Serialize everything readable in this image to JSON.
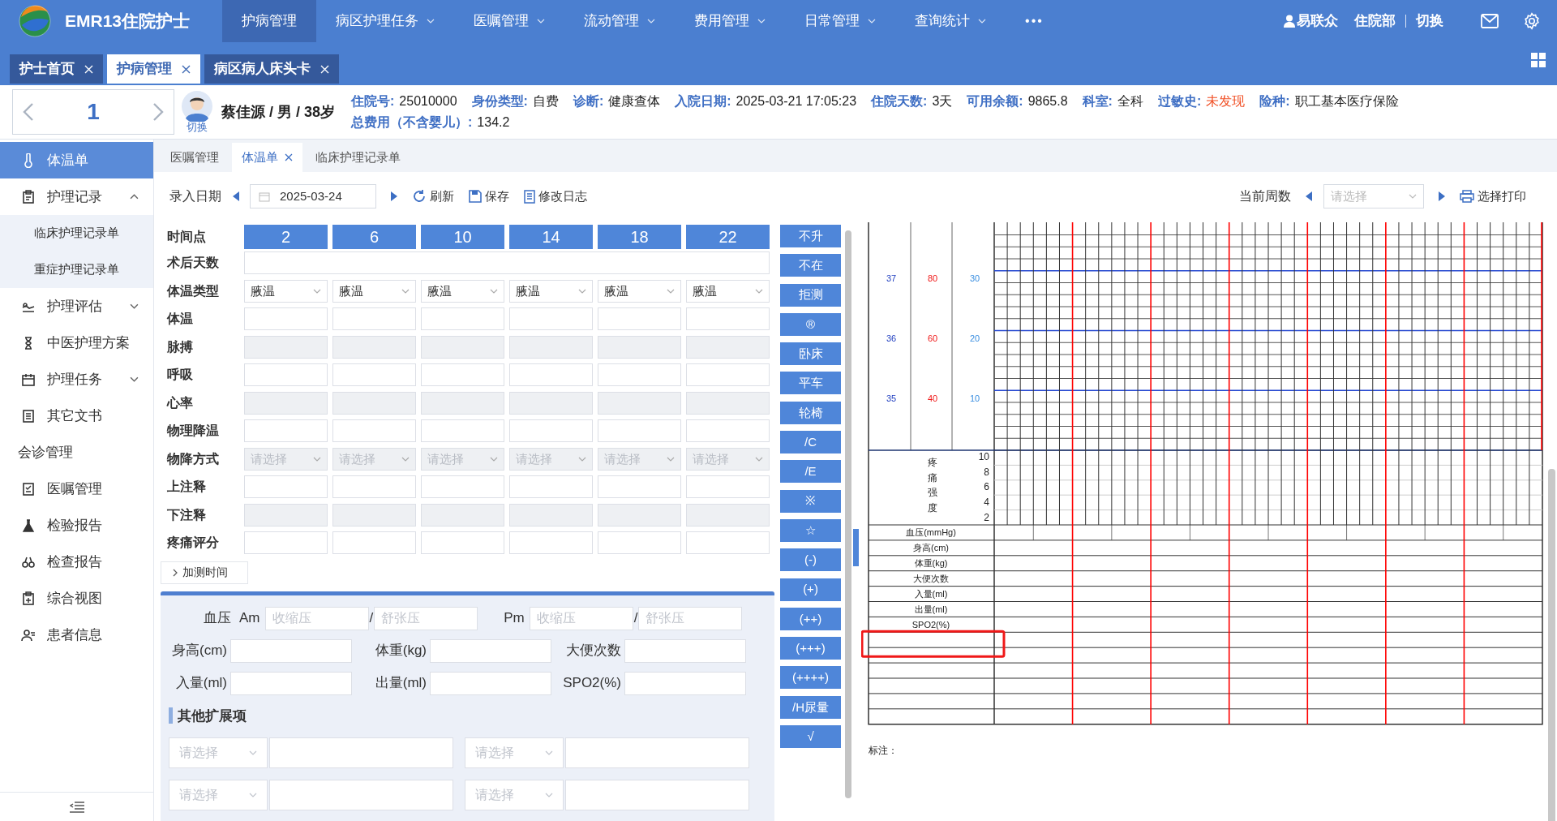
{
  "app": {
    "title": "EMR13住院护士"
  },
  "nav": [
    {
      "label": "护病管理",
      "selected": true,
      "has_menu": false
    },
    {
      "label": "病区护理任务",
      "selected": false,
      "has_menu": true
    },
    {
      "label": "医嘱管理",
      "selected": false,
      "has_menu": true
    },
    {
      "label": "流动管理",
      "selected": false,
      "has_menu": true
    },
    {
      "label": "费用管理",
      "selected": false,
      "has_menu": true
    },
    {
      "label": "日常管理",
      "selected": false,
      "has_menu": true
    },
    {
      "label": "查询统计",
      "selected": false,
      "has_menu": true
    }
  ],
  "nav_more": "•••",
  "user": {
    "name": "易联众",
    "dept": "住院部",
    "switch": "切换"
  },
  "tabs": [
    {
      "label": "护士首页",
      "selected": false
    },
    {
      "label": "护病管理",
      "selected": true
    },
    {
      "label": "病区病人床头卡",
      "selected": false
    }
  ],
  "patient": {
    "bed": "1",
    "switch": "切换",
    "name": "蔡佳源 / 男 / 38岁",
    "fields": [
      {
        "label": "住院号:",
        "value": "25010000",
        "alert": false
      },
      {
        "label": "身份类型:",
        "value": "自费",
        "alert": false
      },
      {
        "label": "诊断:",
        "value": "健康查体",
        "alert": false
      },
      {
        "label": "入院日期:",
        "value": "2025-03-21 17:05:23",
        "alert": false
      },
      {
        "label": "住院天数:",
        "value": "3天",
        "alert": false
      },
      {
        "label": "可用余额:",
        "value": "9865.8",
        "alert": false
      },
      {
        "label": "科室:",
        "value": "全科",
        "alert": false
      },
      {
        "label": "过敏史:",
        "value": "未发现",
        "alert": true
      },
      {
        "label": "险种:",
        "value": "职工基本医疗保险",
        "alert": false
      },
      {
        "label": "总费用（不含婴儿）:",
        "value": "134.2",
        "alert": false
      }
    ]
  },
  "sidebar": [
    {
      "label": "体温单",
      "kind": "item",
      "selected": true
    },
    {
      "label": "护理记录",
      "kind": "group",
      "selected": false,
      "expanded": true,
      "children": [
        {
          "label": "临床护理记录单",
          "selected": false
        },
        {
          "label": "重症护理记录单",
          "selected": false
        }
      ]
    },
    {
      "label": "护理评估",
      "kind": "group",
      "selected": false,
      "expanded": false
    },
    {
      "label": "中医护理方案",
      "kind": "item",
      "selected": false
    },
    {
      "label": "护理任务",
      "kind": "group",
      "selected": false,
      "expanded": false
    },
    {
      "label": "其它文书",
      "kind": "item",
      "selected": false
    },
    {
      "label": "会诊管理",
      "kind": "section",
      "selected": false
    },
    {
      "label": "医嘱管理",
      "kind": "item",
      "selected": false
    },
    {
      "label": "检验报告",
      "kind": "item",
      "selected": false
    },
    {
      "label": "检查报告",
      "kind": "item",
      "selected": false
    },
    {
      "label": "综合视图",
      "kind": "item",
      "selected": false
    },
    {
      "label": "患者信息",
      "kind": "item",
      "selected": false
    }
  ],
  "subtabs": [
    {
      "label": "医嘱管理",
      "selected": false,
      "closable": false
    },
    {
      "label": "体温单",
      "selected": true,
      "closable": true
    },
    {
      "label": "临床护理记录单",
      "selected": false,
      "closable": false
    }
  ],
  "toolbar": {
    "date_label": "录入日期",
    "date": "2025-03-24",
    "refresh": "刷新",
    "save": "保存",
    "log": "修改日志",
    "week_label": "当前周数",
    "week_placeholder": "请选择",
    "print": "选择打印"
  },
  "form": {
    "time_label": "时间点",
    "times": [
      "2",
      "6",
      "10",
      "14",
      "18",
      "22"
    ],
    "rows": [
      {
        "label": "术后天数",
        "kind": "wide",
        "disabled": false
      },
      {
        "label": "体温类型",
        "kind": "select",
        "disabled": false,
        "values": [
          "腋温",
          "腋温",
          "腋温",
          "腋温",
          "腋温",
          "腋温"
        ]
      },
      {
        "label": "体温",
        "kind": "input",
        "disabled": false
      },
      {
        "label": "脉搏",
        "kind": "input",
        "disabled": true
      },
      {
        "label": "呼吸",
        "kind": "input",
        "disabled": false
      },
      {
        "label": "心率",
        "kind": "input",
        "disabled": true
      },
      {
        "label": "物理降温",
        "kind": "input",
        "disabled": false
      },
      {
        "label": "物降方式",
        "kind": "select",
        "disabled": true,
        "placeholders": [
          "请选择",
          "请选择",
          "请选择",
          "请选择",
          "请选择",
          "请选择"
        ]
      },
      {
        "label": "上注释",
        "kind": "input",
        "disabled": false
      },
      {
        "label": "下注释",
        "kind": "input",
        "disabled": true
      },
      {
        "label": "疼痛评分",
        "kind": "input",
        "disabled": false
      }
    ],
    "add_time": "加测时间"
  },
  "vitals": {
    "bp_label": "血压",
    "am": "Am",
    "pm": "Pm",
    "bp_placeholders": [
      "收缩压",
      "舒张压",
      "收缩压",
      "舒张压"
    ],
    "slashes": [
      "/",
      "/"
    ],
    "fields": [
      {
        "label": "身高(cm)"
      },
      {
        "label": "体重(kg)"
      },
      {
        "label": "大便次数"
      },
      {
        "label": "入量(ml)"
      },
      {
        "label": "出量(ml)"
      },
      {
        "label": "SPO2(%)"
      }
    ],
    "ext_title": "其他扩展项",
    "ext_rows": [
      [
        "请选择",
        "请选择"
      ],
      [
        "请选择",
        "请选择"
      ]
    ]
  },
  "symbols": [
    "不升",
    "不在",
    "拒测",
    "®",
    "卧床",
    "平车",
    "轮椅",
    "/C",
    "/E",
    "※",
    "☆",
    "(-)",
    "(+)",
    "(++)",
    "(+++)",
    "(++++)",
    "/H尿量",
    "√"
  ],
  "chart": {
    "temp_ticks": [
      "37",
      "36",
      "35"
    ],
    "pulse_ticks": [
      "80",
      "60",
      "40"
    ],
    "resp_ticks": [
      "30",
      "20",
      "10"
    ],
    "pain_label": "疼痛强度",
    "pain_ticks": [
      "10",
      "8",
      "6",
      "4",
      "2"
    ],
    "rows": [
      "血压(mmHg)",
      "身高(cm)",
      "体重(kg)",
      "大便次数",
      "入量(ml)",
      "出量(ml)",
      "SPO2(%)"
    ],
    "note": "标注："
  }
}
